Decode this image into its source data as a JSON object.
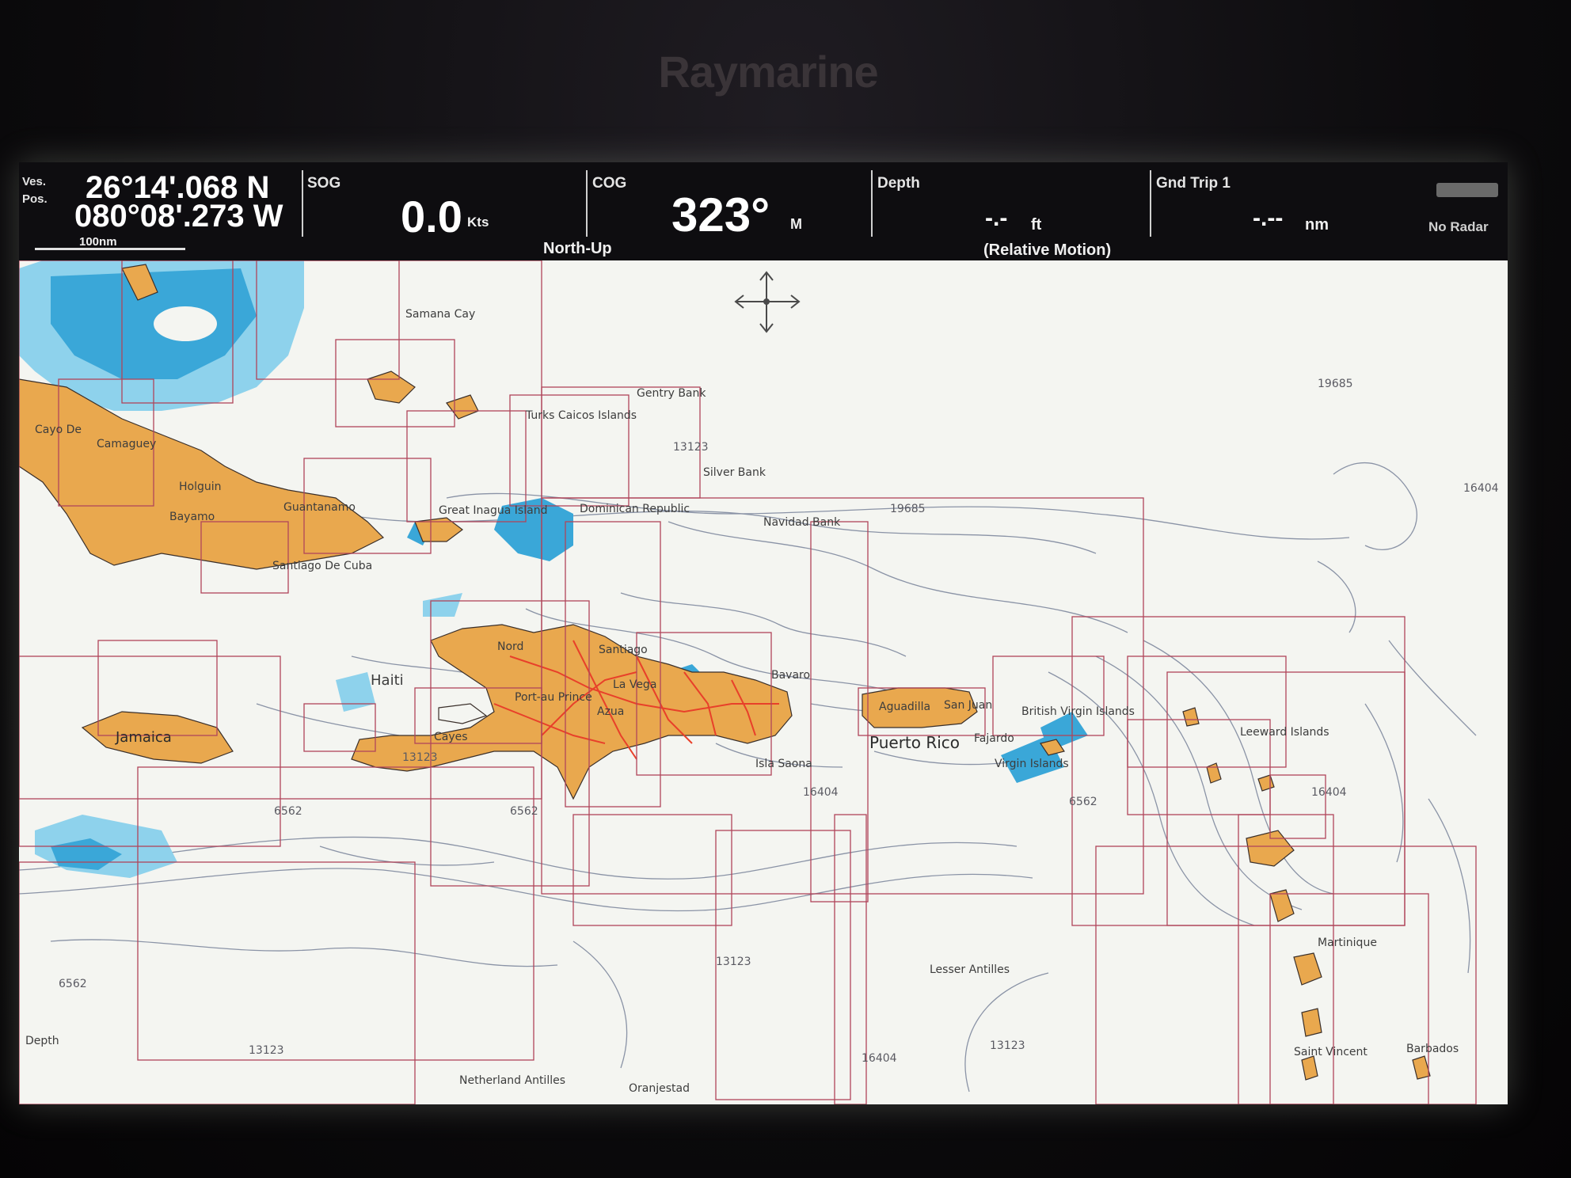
{
  "device": {
    "brand": "Raymarine"
  },
  "databar": {
    "vessel_label_1": "Ves.",
    "vessel_label_2": "Pos.",
    "latitude": "26°14'.068 N",
    "longitude": "080°08'.273 W",
    "scale": "100nm",
    "sog_label": "SOG",
    "sog_value": "0.0",
    "sog_unit": "Kts",
    "cog_label": "COG",
    "cog_value": "323°",
    "cog_unit": "M",
    "orientation": "North-Up",
    "depth_label": "Depth",
    "depth_value": "-.-",
    "depth_unit": "ft",
    "motion_mode": "(Relative Motion)",
    "trip_label": "Gnd Trip 1",
    "trip_value": "-.--",
    "trip_unit": "nm",
    "radar_status": "No Radar"
  },
  "map": {
    "place_labels": {
      "camaguey": "Camaguey",
      "holguin": "Holguin",
      "bayamo": "Bayamo",
      "guantanamo": "Guantanamo",
      "santiago_de_cuba": "Santiago De Cuba",
      "jamaica": "Jamaica",
      "haiti": "Haiti",
      "nord": "Nord",
      "port_au_prince": "Port-au Prince",
      "cayes": "Cayes",
      "dominican_republic": "Dominican Republic",
      "santiago": "Santiago",
      "la_vega": "La Vega",
      "azua": "Azua",
      "bavaro": "Bavaro",
      "isla_saona": "Isla Saona",
      "puerto_rico": "Puerto Rico",
      "aguadilla": "Aguadilla",
      "san_juan": "San Juan",
      "fajardo": "Fajardo",
      "british_virgin_islands": "British Virgin Islands",
      "virgin_islands": "Virgin Islands",
      "leeward_islands": "Leeward Islands",
      "samana_cay": "Samana Cay",
      "great_inagua": "Great Inagua Island",
      "turks_caicos": "Turks Caicos Islands",
      "gentry_bank": "Gentry Bank",
      "silver_bank": "Silver Bank",
      "navidad_bank": "Navidad Bank",
      "lesser_antilles": "Lesser Antilles",
      "netherland_antilles": "Netherland Antilles",
      "oranjestad": "Oranjestad",
      "saint_vincent": "Saint Vincent",
      "barbados": "Barbados",
      "martinique": "Martinique",
      "cayo_de": "Cayo De",
      "depth_tag": "Depth"
    },
    "chart_numbers": {
      "c13123_a": "13123",
      "c13123_b": "13123",
      "c13123_c": "13123",
      "c13123_d": "13123",
      "c13123_e": "13123",
      "c19685_a": "19685",
      "c19685_b": "19685",
      "c16404_a": "16404",
      "c16404_b": "16404",
      "c16404_c": "16404",
      "c16404_d": "16404",
      "c6562_a": "6562",
      "c6562_b": "6562",
      "c6562_c": "6562",
      "c6562_d": "6562"
    },
    "colors": {
      "land": "#e9a84e",
      "shallow_water": "#3aa7d8",
      "shoal_water": "#8ed2ec",
      "deep_water": "#f4f5f1",
      "chart_bounds": "#b0455a",
      "contours": "#8a93a6",
      "roads": "#e8402a"
    }
  }
}
